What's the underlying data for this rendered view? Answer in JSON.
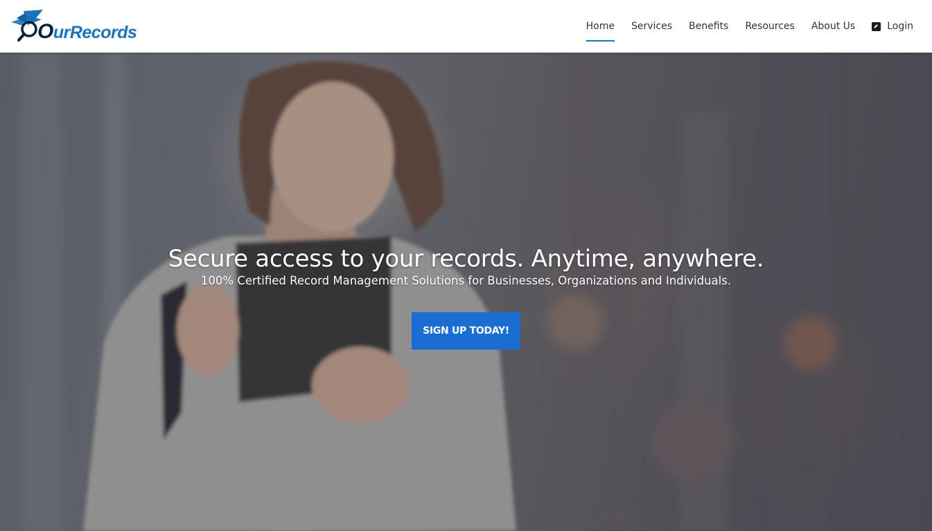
{
  "brand": {
    "logo_text_o": "O",
    "logo_text_rest": "urRecords",
    "logo_color": "#1c74b8",
    "logo_accent": "#0e2237",
    "logo_icon": "magnifier-book-icon"
  },
  "nav": {
    "items": [
      {
        "label": "Home",
        "active": true
      },
      {
        "label": "Services",
        "active": false
      },
      {
        "label": "Benefits",
        "active": false
      },
      {
        "label": "Resources",
        "active": false
      },
      {
        "label": "About Us",
        "active": false
      }
    ],
    "login": {
      "label": "Login",
      "icon": "external-link-icon"
    }
  },
  "hero": {
    "title": "Secure access to your records. Anytime, anywhere.",
    "subtitle": "100% Certified Record Management Solutions for Businesses, Organizations and Individuals.",
    "cta_label": "SIGN UP TODAY!",
    "cta_color": "#1a6ed2",
    "background_image": "woman-with-tablet-photo"
  }
}
